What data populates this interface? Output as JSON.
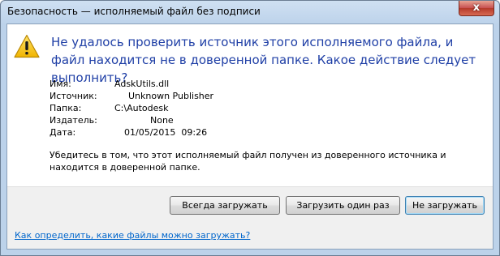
{
  "window": {
    "title": "Безопасность — исполняемый файл без подписи",
    "close_glyph": "x"
  },
  "icon": "warning-icon",
  "heading": "Не удалось проверить источник этого исполняемого файла, и файл находится не в доверенной папке. Какое действие следует выполнить?",
  "details": [
    {
      "label": "Имя:",
      "value": "AdskUtils.dll"
    },
    {
      "label": "Источник:",
      "value": "Unknown Publisher"
    },
    {
      "label": "Папка:",
      "value": "C:\\Autodesk"
    },
    {
      "label": "Издатель:",
      "value": "None"
    },
    {
      "label": "Дата:",
      "value": "01/05/2015  09:26"
    }
  ],
  "note": "Убедитесь в том, что этот исполняемый файл получен из доверенного источника и находится в доверенной папке.",
  "buttons": {
    "always_load": "Всегда загружать",
    "load_once": "Загрузить один раз",
    "dont_load": "Не загружать"
  },
  "footer_link": "Как определить, какие файлы можно загружать?",
  "colors": {
    "heading": "#1f3fa6",
    "link": "#0066cc",
    "warning": "#f2c200"
  }
}
